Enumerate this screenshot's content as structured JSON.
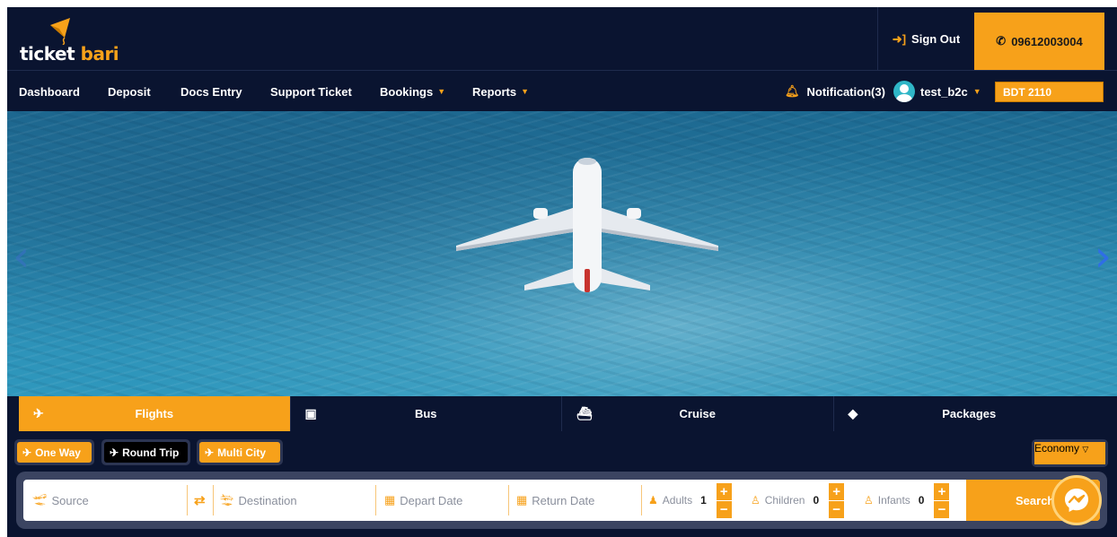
{
  "brand": {
    "name_part1": "ticket ",
    "name_part2": "bari"
  },
  "header": {
    "signout_label": "Sign Out",
    "phone": "09612003004"
  },
  "nav": {
    "items": [
      {
        "label": "Dashboard"
      },
      {
        "label": "Deposit"
      },
      {
        "label": "Docs Entry"
      },
      {
        "label": "Support Ticket"
      },
      {
        "label": "Bookings"
      },
      {
        "label": "Reports"
      }
    ],
    "notification_label": "Notification(3)",
    "username": "test_b2c",
    "balance": "BDT 2110"
  },
  "services": {
    "tabs": [
      {
        "label": "Flights",
        "icon": "plane-icon"
      },
      {
        "label": "Bus",
        "icon": "bus-icon"
      },
      {
        "label": "Cruise",
        "icon": "ship-icon"
      },
      {
        "label": "Packages",
        "icon": "diamond-icon"
      }
    ],
    "active": "Flights"
  },
  "trip_types": {
    "one_way": "One Way",
    "round_trip": "Round Trip",
    "multi_city": "Multi City",
    "selected": "Round Trip"
  },
  "cabin_class": "Economy",
  "search": {
    "source_placeholder": "Source",
    "destination_placeholder": "Destination",
    "depart_placeholder": "Depart Date",
    "return_placeholder": "Return Date",
    "adults_label": "Adults",
    "adults_count": "1",
    "children_label": "Children",
    "children_count": "0",
    "infants_label": "Infants",
    "infants_count": "0",
    "search_button": "Search"
  },
  "colors": {
    "navy": "#0a1430",
    "accent": "#f7a11a",
    "panel": "#3b4461"
  }
}
